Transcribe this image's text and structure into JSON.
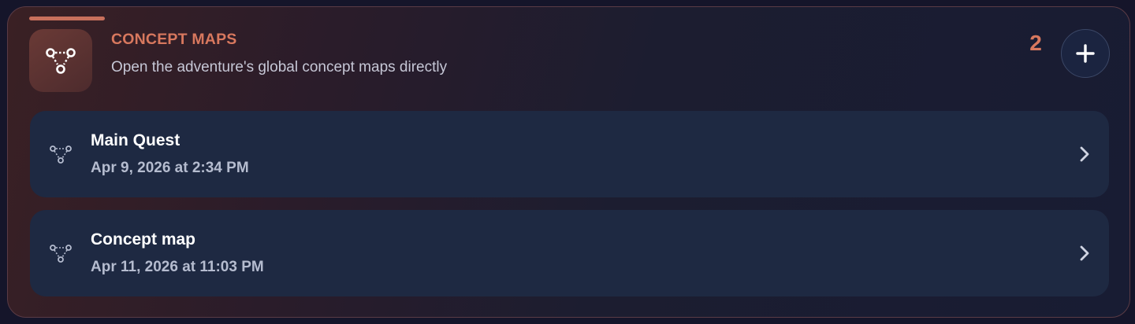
{
  "section": {
    "title": "CONCEPT MAPS",
    "subtitle": "Open the adventure's global concept maps directly",
    "count": "2",
    "icon": "concept-map-icon",
    "add_icon": "plus-icon"
  },
  "maps": [
    {
      "name": "Main Quest",
      "date": "Apr 9, 2026 at 2:34 PM",
      "icon": "concept-map-icon"
    },
    {
      "name": "Concept map",
      "date": "Apr 11, 2026 at 11:03 PM",
      "icon": "concept-map-icon"
    }
  ],
  "colors": {
    "accent": "#d8785e",
    "row_background": "#1e2942",
    "page_background": "#15152a"
  }
}
